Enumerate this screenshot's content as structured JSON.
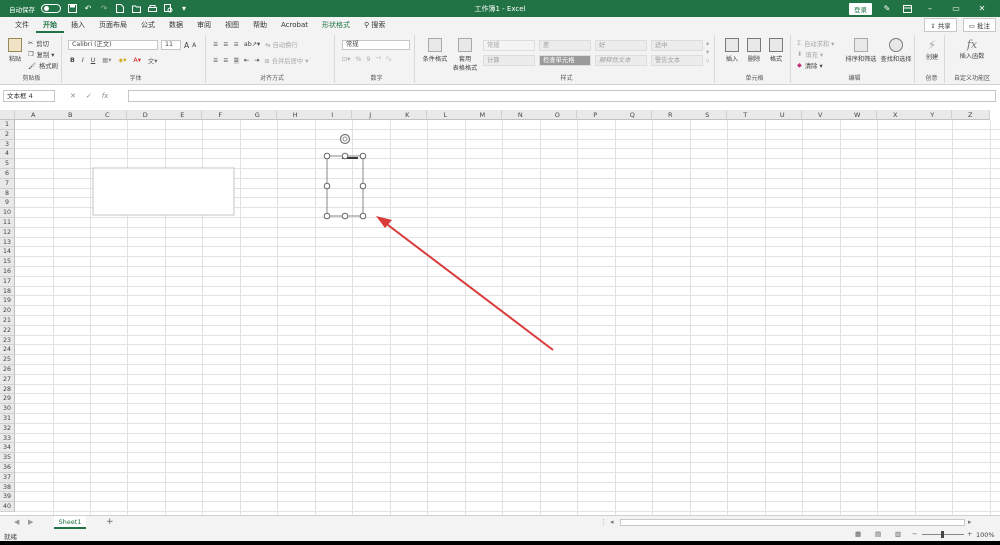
{
  "titlebar": {
    "autosave_label": "自动保存",
    "autosave_state": "关",
    "title": "工作簿1 - Excel",
    "login_label": "登录",
    "minimize_label": "–",
    "restore_label": "▭",
    "close_label": "✕"
  },
  "tabs": [
    "文件",
    "开始",
    "插入",
    "页面布局",
    "公式",
    "数据",
    "审阅",
    "视图",
    "帮助",
    "Acrobat",
    "形状格式"
  ],
  "active_tab": "开始",
  "search_label": "搜索",
  "share_label": "共享",
  "comment_label": "批注",
  "ribbon": {
    "clipboard": {
      "paste": "粘贴",
      "cut": "剪切",
      "copy": "复制 ▾",
      "format_painter": "格式刷",
      "label": "剪贴板"
    },
    "font": {
      "name": "Calibri (正文)",
      "size": "11",
      "grow": "A",
      "shrink": "A",
      "bold": "B",
      "italic": "I",
      "underline": "U",
      "label": "字体"
    },
    "alignment": {
      "wrap": "自动换行",
      "merge": "合并后居中 ▾",
      "label": "对齐方式"
    },
    "number": {
      "format": "常规",
      "percent": "%",
      "comma": "9",
      "label": "数字"
    },
    "styles": {
      "conditional": "条件格式",
      "table": "套用\n表格格式",
      "cells": [
        "常规",
        "差",
        "好",
        "适中",
        "计算",
        "检查单元格",
        "解释性文本",
        "警告文本"
      ],
      "label": "样式"
    },
    "cells": {
      "insert": "插入",
      "delete": "删除",
      "format": "格式",
      "label": "单元格"
    },
    "editing": {
      "autosum": "自动求和 ▾",
      "fill": "填充 ▾",
      "clear": "清除 ▾",
      "sort": "排序和筛选",
      "find": "查找和选择",
      "label": "编辑"
    },
    "create": {
      "label_btn": "创建",
      "label": "创意"
    },
    "custom": {
      "insert_fn": "插入函数",
      "label": "自定义功能区"
    }
  },
  "formula_bar": {
    "name_box": "文本框 4",
    "cancel": "✕",
    "enter": "✓",
    "fx": "fx",
    "value": ""
  },
  "columns": [
    "A",
    "B",
    "C",
    "D",
    "E",
    "F",
    "G",
    "H",
    "I",
    "J",
    "K",
    "L",
    "M",
    "N",
    "O",
    "P",
    "Q",
    "R",
    "S",
    "T",
    "U",
    "V",
    "W",
    "X",
    "Y",
    "Z"
  ],
  "rows": [
    "1",
    "2",
    "3",
    "4",
    "5",
    "6",
    "7",
    "8",
    "9",
    "10",
    "11",
    "12",
    "13",
    "14",
    "15",
    "16",
    "17",
    "18",
    "19",
    "20",
    "21",
    "22",
    "23",
    "24",
    "25",
    "26",
    "27",
    "28",
    "29",
    "30",
    "31",
    "32",
    "33",
    "34",
    "35",
    "36",
    "37",
    "38",
    "39",
    "40"
  ],
  "sheets": [
    "Sheet1"
  ],
  "add_sheet": "+",
  "status": {
    "ready": "就绪",
    "zoom": "100%"
  },
  "colors": {
    "excel_green": "#217346",
    "arrow_red": "#d93b3b"
  }
}
